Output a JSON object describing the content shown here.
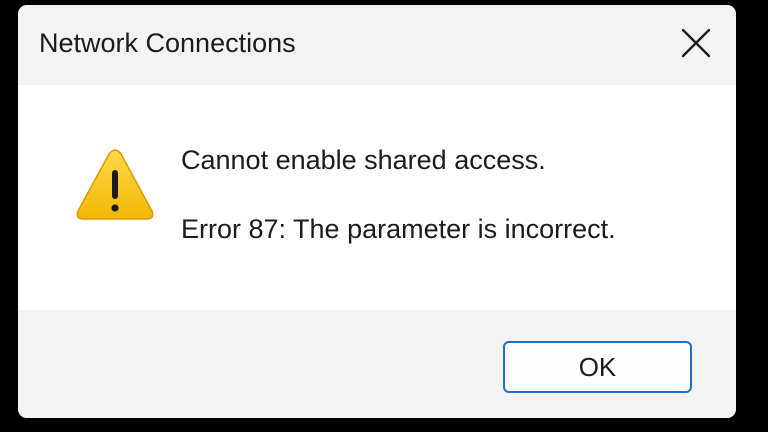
{
  "dialog": {
    "title": "Network Connections",
    "close_icon": "close-icon",
    "icon": "warning-icon",
    "message": "Cannot enable shared access.",
    "error_detail": "Error 87: The parameter is incorrect.",
    "ok_label": "OK"
  },
  "colors": {
    "warning_fill": "#f8c61a",
    "button_border": "#1f6fc5",
    "content_bg": "#ffffff",
    "chrome_bg": "#f3f3f3"
  }
}
